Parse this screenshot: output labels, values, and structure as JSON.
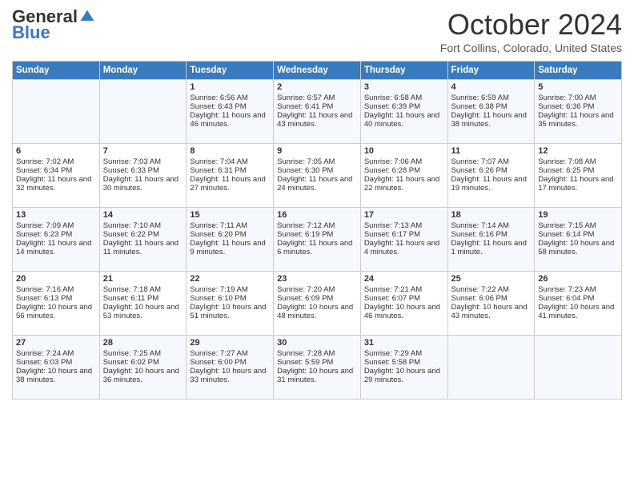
{
  "header": {
    "logo_general": "General",
    "logo_blue": "Blue",
    "month_title": "October 2024",
    "location": "Fort Collins, Colorado, United States"
  },
  "days_of_week": [
    "Sunday",
    "Monday",
    "Tuesday",
    "Wednesday",
    "Thursday",
    "Friday",
    "Saturday"
  ],
  "weeks": [
    [
      {
        "day": "",
        "empty": true
      },
      {
        "day": "",
        "empty": true
      },
      {
        "day": "1",
        "sunrise": "Sunrise: 6:56 AM",
        "sunset": "Sunset: 6:43 PM",
        "daylight": "Daylight: 11 hours and 46 minutes."
      },
      {
        "day": "2",
        "sunrise": "Sunrise: 6:57 AM",
        "sunset": "Sunset: 6:41 PM",
        "daylight": "Daylight: 11 hours and 43 minutes."
      },
      {
        "day": "3",
        "sunrise": "Sunrise: 6:58 AM",
        "sunset": "Sunset: 6:39 PM",
        "daylight": "Daylight: 11 hours and 40 minutes."
      },
      {
        "day": "4",
        "sunrise": "Sunrise: 6:59 AM",
        "sunset": "Sunset: 6:38 PM",
        "daylight": "Daylight: 11 hours and 38 minutes."
      },
      {
        "day": "5",
        "sunrise": "Sunrise: 7:00 AM",
        "sunset": "Sunset: 6:36 PM",
        "daylight": "Daylight: 11 hours and 35 minutes."
      }
    ],
    [
      {
        "day": "6",
        "sunrise": "Sunrise: 7:02 AM",
        "sunset": "Sunset: 6:34 PM",
        "daylight": "Daylight: 11 hours and 32 minutes."
      },
      {
        "day": "7",
        "sunrise": "Sunrise: 7:03 AM",
        "sunset": "Sunset: 6:33 PM",
        "daylight": "Daylight: 11 hours and 30 minutes."
      },
      {
        "day": "8",
        "sunrise": "Sunrise: 7:04 AM",
        "sunset": "Sunset: 6:31 PM",
        "daylight": "Daylight: 11 hours and 27 minutes."
      },
      {
        "day": "9",
        "sunrise": "Sunrise: 7:05 AM",
        "sunset": "Sunset: 6:30 PM",
        "daylight": "Daylight: 11 hours and 24 minutes."
      },
      {
        "day": "10",
        "sunrise": "Sunrise: 7:06 AM",
        "sunset": "Sunset: 6:28 PM",
        "daylight": "Daylight: 11 hours and 22 minutes."
      },
      {
        "day": "11",
        "sunrise": "Sunrise: 7:07 AM",
        "sunset": "Sunset: 6:26 PM",
        "daylight": "Daylight: 11 hours and 19 minutes."
      },
      {
        "day": "12",
        "sunrise": "Sunrise: 7:08 AM",
        "sunset": "Sunset: 6:25 PM",
        "daylight": "Daylight: 11 hours and 17 minutes."
      }
    ],
    [
      {
        "day": "13",
        "sunrise": "Sunrise: 7:09 AM",
        "sunset": "Sunset: 6:23 PM",
        "daylight": "Daylight: 11 hours and 14 minutes."
      },
      {
        "day": "14",
        "sunrise": "Sunrise: 7:10 AM",
        "sunset": "Sunset: 6:22 PM",
        "daylight": "Daylight: 11 hours and 11 minutes."
      },
      {
        "day": "15",
        "sunrise": "Sunrise: 7:11 AM",
        "sunset": "Sunset: 6:20 PM",
        "daylight": "Daylight: 11 hours and 9 minutes."
      },
      {
        "day": "16",
        "sunrise": "Sunrise: 7:12 AM",
        "sunset": "Sunset: 6:19 PM",
        "daylight": "Daylight: 11 hours and 6 minutes."
      },
      {
        "day": "17",
        "sunrise": "Sunrise: 7:13 AM",
        "sunset": "Sunset: 6:17 PM",
        "daylight": "Daylight: 11 hours and 4 minutes."
      },
      {
        "day": "18",
        "sunrise": "Sunrise: 7:14 AM",
        "sunset": "Sunset: 6:16 PM",
        "daylight": "Daylight: 11 hours and 1 minute."
      },
      {
        "day": "19",
        "sunrise": "Sunrise: 7:15 AM",
        "sunset": "Sunset: 6:14 PM",
        "daylight": "Daylight: 10 hours and 58 minutes."
      }
    ],
    [
      {
        "day": "20",
        "sunrise": "Sunrise: 7:16 AM",
        "sunset": "Sunset: 6:13 PM",
        "daylight": "Daylight: 10 hours and 56 minutes."
      },
      {
        "day": "21",
        "sunrise": "Sunrise: 7:18 AM",
        "sunset": "Sunset: 6:11 PM",
        "daylight": "Daylight: 10 hours and 53 minutes."
      },
      {
        "day": "22",
        "sunrise": "Sunrise: 7:19 AM",
        "sunset": "Sunset: 6:10 PM",
        "daylight": "Daylight: 10 hours and 51 minutes."
      },
      {
        "day": "23",
        "sunrise": "Sunrise: 7:20 AM",
        "sunset": "Sunset: 6:09 PM",
        "daylight": "Daylight: 10 hours and 48 minutes."
      },
      {
        "day": "24",
        "sunrise": "Sunrise: 7:21 AM",
        "sunset": "Sunset: 6:07 PM",
        "daylight": "Daylight: 10 hours and 46 minutes."
      },
      {
        "day": "25",
        "sunrise": "Sunrise: 7:22 AM",
        "sunset": "Sunset: 6:06 PM",
        "daylight": "Daylight: 10 hours and 43 minutes."
      },
      {
        "day": "26",
        "sunrise": "Sunrise: 7:23 AM",
        "sunset": "Sunset: 6:04 PM",
        "daylight": "Daylight: 10 hours and 41 minutes."
      }
    ],
    [
      {
        "day": "27",
        "sunrise": "Sunrise: 7:24 AM",
        "sunset": "Sunset: 6:03 PM",
        "daylight": "Daylight: 10 hours and 38 minutes."
      },
      {
        "day": "28",
        "sunrise": "Sunrise: 7:25 AM",
        "sunset": "Sunset: 6:02 PM",
        "daylight": "Daylight: 10 hours and 36 minutes."
      },
      {
        "day": "29",
        "sunrise": "Sunrise: 7:27 AM",
        "sunset": "Sunset: 6:00 PM",
        "daylight": "Daylight: 10 hours and 33 minutes."
      },
      {
        "day": "30",
        "sunrise": "Sunrise: 7:28 AM",
        "sunset": "Sunset: 5:59 PM",
        "daylight": "Daylight: 10 hours and 31 minutes."
      },
      {
        "day": "31",
        "sunrise": "Sunrise: 7:29 AM",
        "sunset": "Sunset: 5:58 PM",
        "daylight": "Daylight: 10 hours and 29 minutes."
      },
      {
        "day": "",
        "empty": true
      },
      {
        "day": "",
        "empty": true
      }
    ]
  ]
}
